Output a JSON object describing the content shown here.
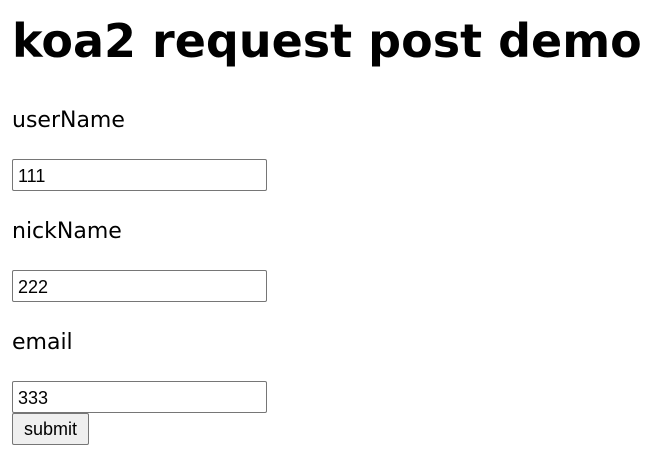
{
  "header": {
    "title": "koa2 request post demo"
  },
  "form": {
    "fields": [
      {
        "label": "userName",
        "value": "111"
      },
      {
        "label": "nickName",
        "value": "222"
      },
      {
        "label": "email",
        "value": "333"
      }
    ],
    "submit_label": "submit"
  }
}
